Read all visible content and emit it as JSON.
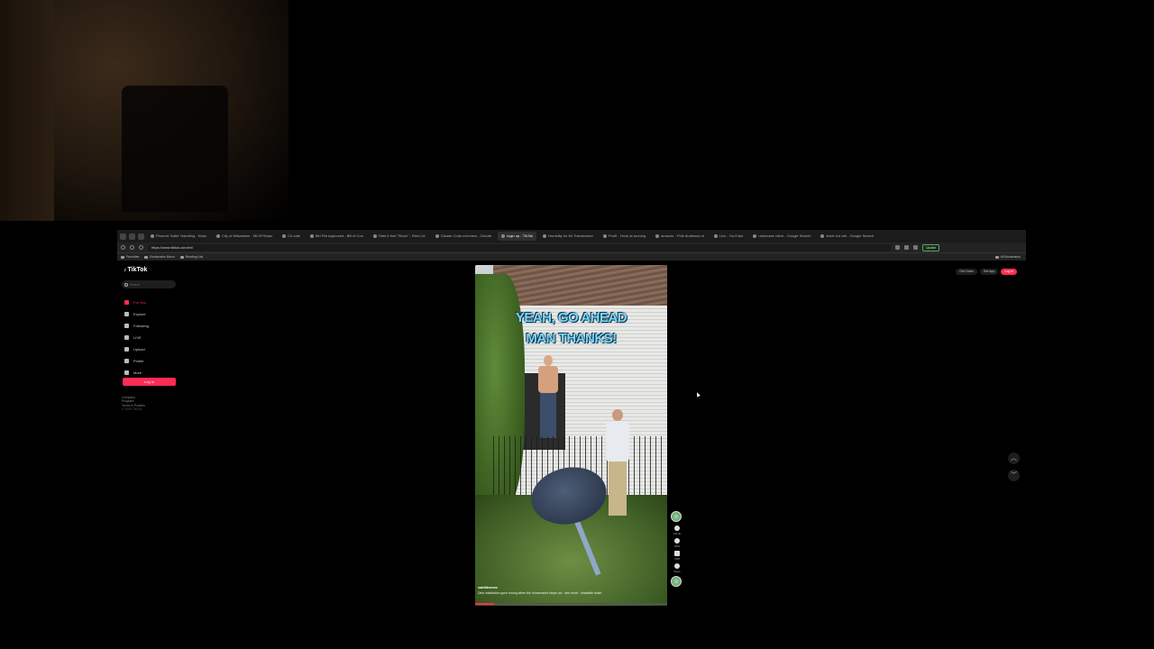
{
  "browser": {
    "tabs": [
      {
        "label": "Phoenix 'Katie' Handling · Noac"
      },
      {
        "label": "City of Milwaukee · MLKP/Noac"
      },
      {
        "label": "Ch.cale"
      },
      {
        "label": "Bid File Approved - Bill of Con"
      },
      {
        "label": "Rate it thot \"Stock\" - Reel.CA"
      },
      {
        "label": "Claude Code overview - Claude"
      },
      {
        "label": "login up - TikTok",
        "active": true
      },
      {
        "label": "Humidity for Mr Transformer"
      },
      {
        "label": "Profit - Hook at running"
      },
      {
        "label": "amazon - Pole Audience.nt"
      },
      {
        "label": "Live - YouTube"
      },
      {
        "label": "ustrecase client - Google Search"
      },
      {
        "label": "short cut call - Google Search"
      }
    ],
    "url": "https://www.tiktok.com/en/",
    "update_label": "Update",
    "bookmarks": [
      "Favorites",
      "Bookmarks Menu",
      "Reading List"
    ],
    "all_bookmarks": "All Bookmarks"
  },
  "tiktok": {
    "logo": "TikTok",
    "search_placeholder": "Search",
    "nav": [
      {
        "label": "For You",
        "icon": "home-icon",
        "active": true
      },
      {
        "label": "Explore",
        "icon": "compass-icon"
      },
      {
        "label": "Following",
        "icon": "following-icon"
      },
      {
        "label": "LIVE",
        "icon": "live-icon"
      },
      {
        "label": "Upload",
        "icon": "upload-icon"
      },
      {
        "label": "Profile",
        "icon": "profile-icon"
      },
      {
        "label": "More",
        "icon": "more-icon"
      }
    ],
    "login_label": "Log in",
    "footer": [
      "Company",
      "Program",
      "Terms & Policies",
      "© 2025 TikTok"
    ],
    "top_right": {
      "get_coins": "Get Coins",
      "get_app": "Get App",
      "login": "Log in"
    },
    "video": {
      "caption_line1": "YEAH, GO AHEAD",
      "caption_line2": "MAN THANKS!",
      "user": "satellitenews",
      "description": "Dish installation gone wrong when the homeowner steps out · see more · #satellite #dish",
      "progress_percent": 10
    },
    "actions": [
      {
        "icon": "heart-icon",
        "count": "142.3K"
      },
      {
        "icon": "comment-icon",
        "count": "3051"
      },
      {
        "icon": "bookmark-icon",
        "count": "7826"
      },
      {
        "icon": "share-icon",
        "count": "Share"
      }
    ],
    "colors": {
      "accent": "#fe2c55",
      "caption": "#7fd6f5"
    }
  }
}
